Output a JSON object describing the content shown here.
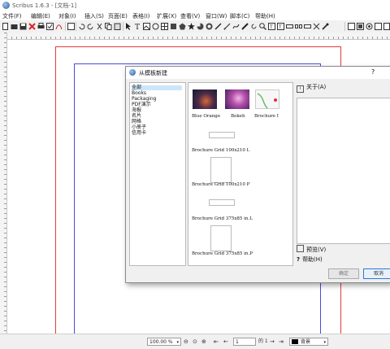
{
  "window": {
    "title": "Scribus 1.6.3 - [文档-1]"
  },
  "menu": [
    "文件(F)",
    "编辑(E)",
    "对象(I)",
    "插入(S)",
    "页面(E)",
    "表格(I)",
    "扩展(X)",
    "查看(V)",
    "窗口(W)",
    "脚本(C)",
    "帮助(H)"
  ],
  "dialog": {
    "title": "从模板新建",
    "help": "?",
    "categories": [
      "全部",
      "Books",
      "Packaging",
      "PDF演示",
      "海报",
      "名片",
      "网格",
      "小册子",
      "信用卡"
    ],
    "selected_category": 0,
    "templates": [
      "Blue Orange",
      "Bokeh",
      "Brochure I",
      "Brochure Grid 100x210 L",
      "Brochure Grid 100x210 P",
      "Brochure Grid 375x85 in.L",
      "Brochure Grid 375x85 in.P"
    ],
    "about_label": "关于(A)",
    "preview_label": "预览(V)",
    "help_label": "帮助(H)",
    "ok_label": "确定",
    "cancel_label": "取消"
  },
  "statusbar": {
    "zoom": "100.00 %",
    "page_number": "1",
    "page_of": "的 1",
    "layer": "背景"
  },
  "colors": {
    "margin_guide": "#e23b3b",
    "page_border": "#4a4ad8",
    "selection": "#cde5f9",
    "accent": "#2a7ad5"
  }
}
